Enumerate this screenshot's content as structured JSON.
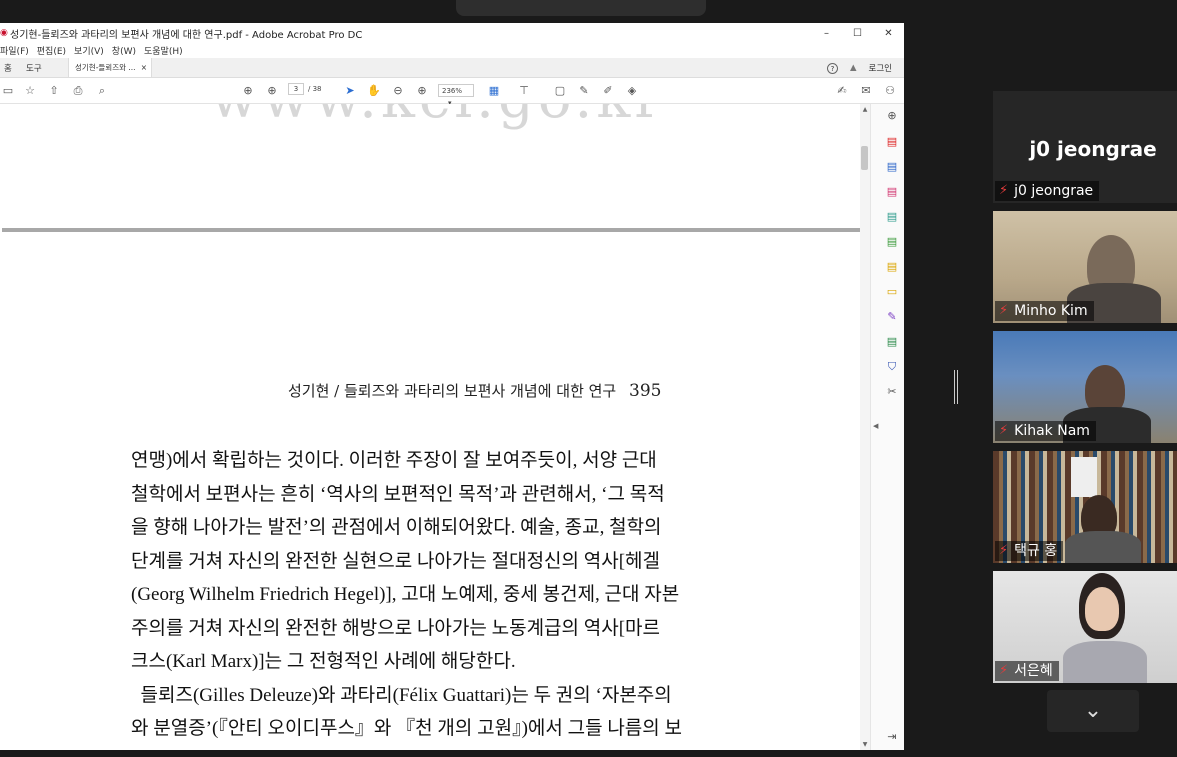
{
  "window": {
    "title": "성기현-들뢰즈와 과타리의 보편사 개념에 대한 연구.pdf - Adobe Acrobat Pro DC",
    "pdf_icon": "pdf-icon",
    "minimize": "–",
    "maximize": "☐",
    "close": "✕"
  },
  "menu": [
    "파일(F)",
    "편집(E)",
    "보기(V)",
    "창(W)",
    "도움말(H)"
  ],
  "tabs": {
    "home": "홈",
    "tools": "도구",
    "doc": "성기현-들뢰즈와 ...",
    "doc_close": "×",
    "help": "?",
    "bell": "bell-icon",
    "login": "로그인"
  },
  "toolbar": {
    "page_current": "3",
    "page_total": "/ 38",
    "zoom": "236%",
    "zoom_arrow": "▾"
  },
  "document": {
    "watermark": "www.kci.go.kr",
    "running_head": "성기현 / 들뢰즈와 과타리의 보편사 개념에 대한 연구",
    "page_number": "395",
    "lines": [
      "연맹)에서 확립하는 것이다. 이러한 주장이 잘 보여주듯이, 서양 근대",
      "철학에서 보편사는 흔히 ‘역사의 보편적인 목적’과 관련해서, ‘그 목적",
      "을 향해 나아가는 발전’의 관점에서 이해되어왔다. 예술, 종교, 철학의",
      "단계를 거쳐 자신의 완전한 실현으로 나아가는 절대정신의 역사[헤겔",
      "(Georg Wilhelm Friedrich Hegel)], 고대 노예제, 중세 봉건제, 근대 자본",
      "주의를 거쳐 자신의 완전한 해방으로 나아가는 노동계급의 역사[마르",
      "크스(Karl Marx)]는 그 전형적인 사례에 해당한다.",
      "  들뢰즈(Gilles Deleuze)와 과타리(Félix Guattari)는 두 권의 ‘자본주의",
      "와 분열증’(『안티 오이디푸스』와 『천 개의 고원』)에서 그들 나름의 보"
    ]
  },
  "participants": [
    {
      "name": "j0 jeongrae",
      "muted": true,
      "video": false,
      "big_label": "j0 jeongrae"
    },
    {
      "name": "Minho Kim",
      "muted": true,
      "video": true
    },
    {
      "name": "Kihak Nam",
      "muted": true,
      "video": true
    },
    {
      "name": "택규 홍",
      "muted": true,
      "video": true
    },
    {
      "name": "서은혜",
      "muted": true,
      "video": true
    }
  ],
  "scroll_down": "⌄"
}
